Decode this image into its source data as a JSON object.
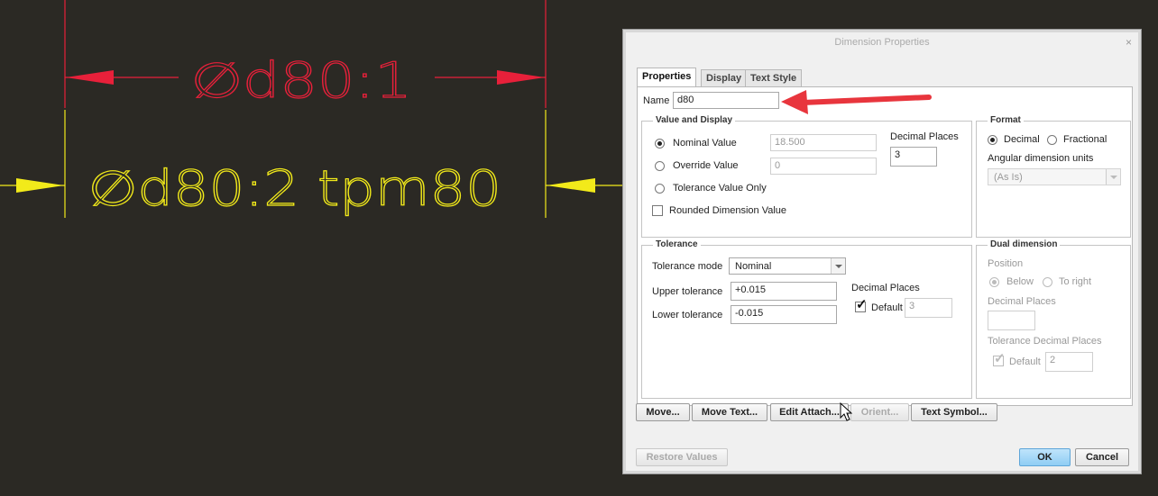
{
  "drawing": {
    "top_dimension_text": "∅d80:1",
    "bottom_dimension_text": "∅d80:2 tpm80",
    "top_color": "#e8203a",
    "bottom_color": "#f2ea1a"
  },
  "dialog": {
    "title": "Dimension Properties",
    "close_glyph": "×",
    "tabs": [
      "Properties",
      "Display",
      "Text Style"
    ],
    "name_label": "Name",
    "name_value": "d80",
    "value_display": {
      "title": "Value and Display",
      "nominal_label": "Nominal Value",
      "nominal_value": "18.500",
      "override_label": "Override Value",
      "override_value": "0",
      "tol_only_label": "Tolerance Value Only",
      "rounded_label": "Rounded Dimension Value",
      "decimal_places_label": "Decimal Places",
      "decimal_places_value": "3"
    },
    "format": {
      "title": "Format",
      "decimal_label": "Decimal",
      "fractional_label": "Fractional",
      "angular_label": "Angular dimension units",
      "angular_value": "(As Is)"
    },
    "tolerance": {
      "title": "Tolerance",
      "mode_label": "Tolerance mode",
      "mode_value": "Nominal",
      "upper_label": "Upper tolerance",
      "upper_value": "+0.015",
      "lower_label": "Lower tolerance",
      "lower_value": "-0.015",
      "decimal_places_label": "Decimal Places",
      "default_label": "Default",
      "default_value": "3"
    },
    "dual": {
      "title": "Dual dimension",
      "position_label": "Position",
      "below_label": "Below",
      "right_label": "To right",
      "decimal_places_label": "Decimal Places",
      "decimal_places_value": "",
      "tol_decimal_label": "Tolerance Decimal Places",
      "default_label": "Default",
      "default_value": "2"
    },
    "buttons": {
      "move": "Move...",
      "move_text": "Move Text...",
      "edit_attach": "Edit Attach...",
      "orient": "Orient...",
      "text_symbol": "Text Symbol...",
      "restore": "Restore Values",
      "ok": "OK",
      "cancel": "Cancel"
    }
  },
  "annotation_arrow_color": "#e8353d"
}
